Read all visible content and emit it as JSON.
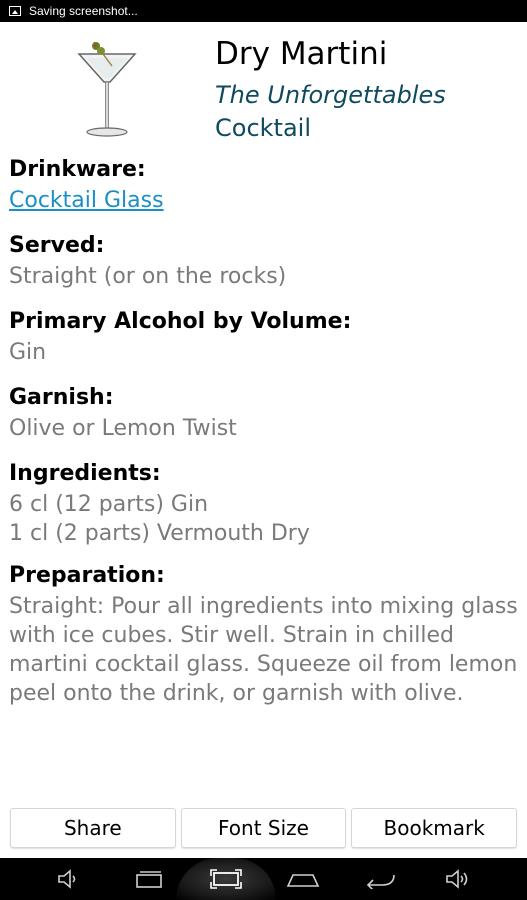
{
  "status_bar": {
    "notification": "Saving screenshot..."
  },
  "drink": {
    "name": "Dry Martini",
    "collection": "The Unforgettables",
    "category": "Cocktail"
  },
  "details": {
    "drinkware_label": "Drinkware:",
    "drinkware_value": "Cocktail Glass",
    "served_label": "Served:",
    "served_value": "Straight (or on the rocks)",
    "alcohol_label": "Primary Alcohol by Volume:",
    "alcohol_value": "Gin",
    "garnish_label": "Garnish:",
    "garnish_value": "Olive or Lemon Twist",
    "ingredients_label": "Ingredients:",
    "ingredients": [
      "6 cl (12 parts) Gin",
      "1 cl (2 parts) Vermouth Dry"
    ],
    "preparation_label": "Preparation:",
    "preparation_value": "Straight: Pour all ingredients into mixing glass with ice cubes. Stir well. Strain in chilled martini cocktail glass. Squeeze oil from lemon peel onto the drink, or garnish with olive."
  },
  "buttons": {
    "share": "Share",
    "font_size": "Font Size",
    "bookmark": "Bookmark"
  },
  "nav_icons": [
    "volume-down-icon",
    "back-icon",
    "screenshot-icon",
    "home-icon",
    "recents-icon",
    "volume-up-icon"
  ],
  "colors": {
    "subtitle": "#0f4a5e",
    "link": "#1a8fc7",
    "value_text": "#7a7a7a"
  }
}
